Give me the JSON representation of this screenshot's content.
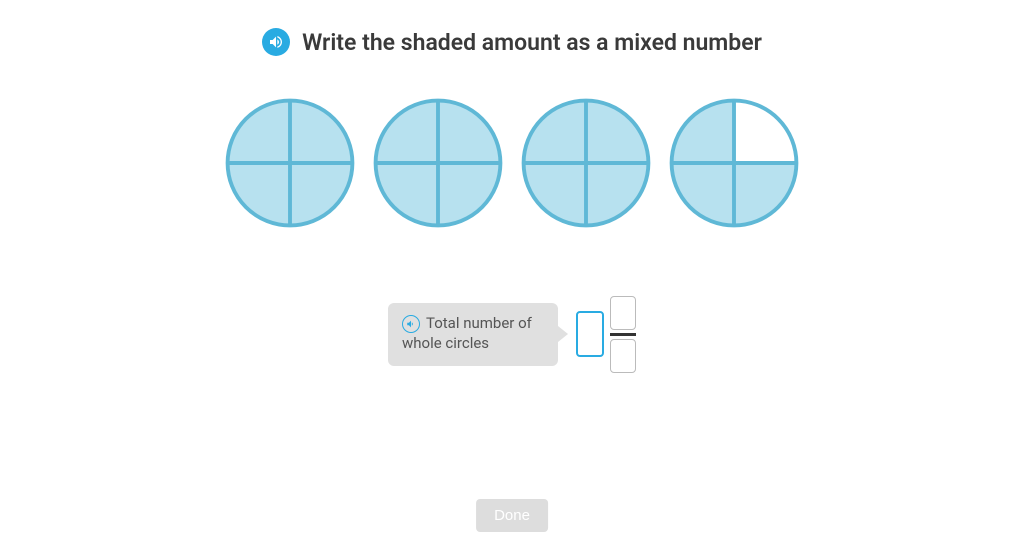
{
  "question": "Write the shaded amount as a mixed number",
  "hint": "Total number of whole circles",
  "done_label": "Done",
  "colors": {
    "circle_fill": "#b7e1ef",
    "circle_stroke": "#5fb8d6"
  },
  "circles": [
    {
      "quarters_shaded": 4
    },
    {
      "quarters_shaded": 4
    },
    {
      "quarters_shaded": 4
    },
    {
      "quarters_shaded": 3,
      "unshaded_index": 1
    }
  ],
  "inputs": {
    "whole": "",
    "numerator": "",
    "denominator": ""
  }
}
